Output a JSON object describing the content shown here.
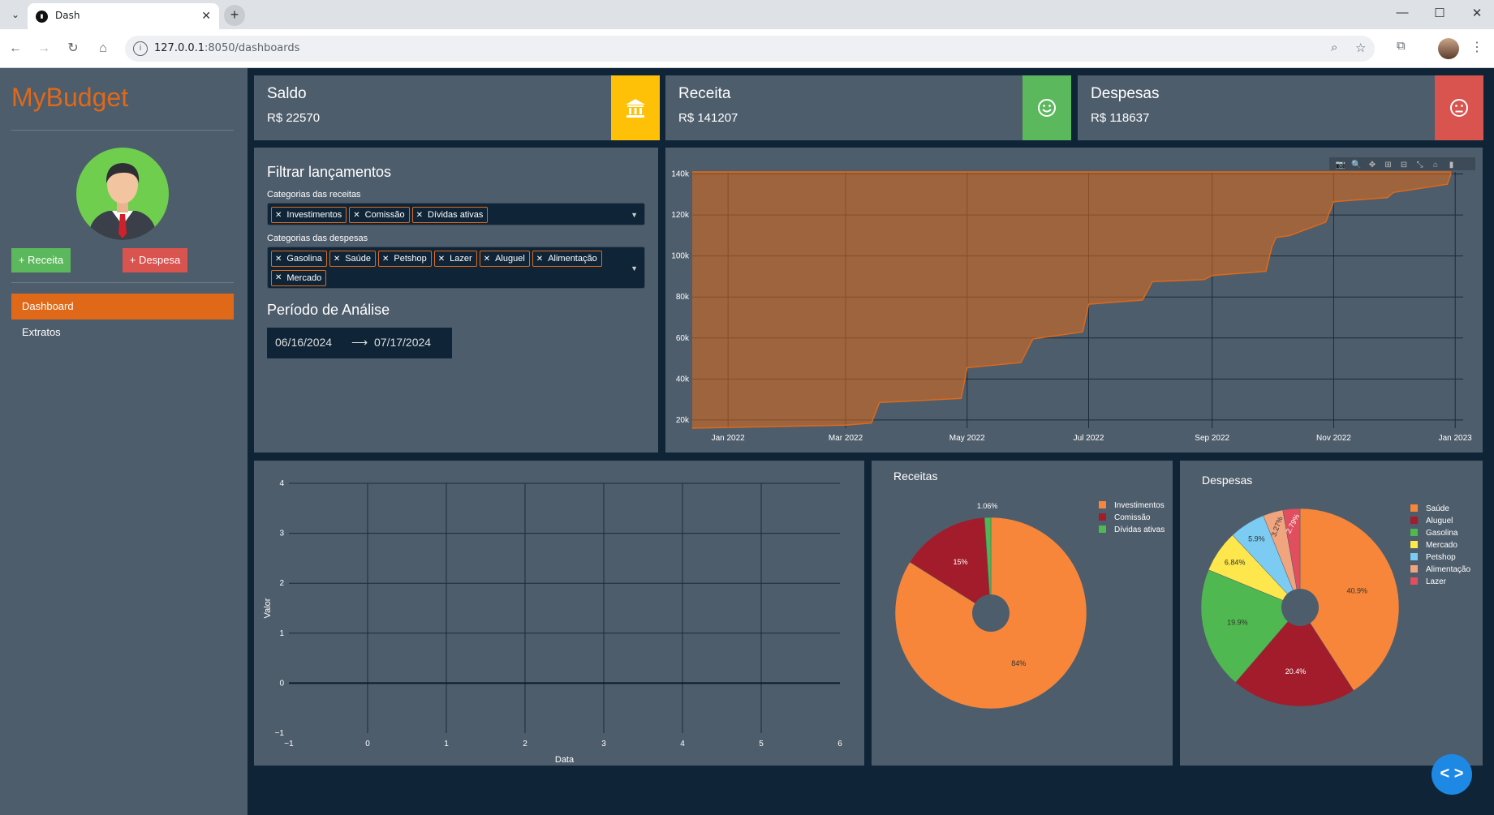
{
  "browser": {
    "tab_title": "Dash",
    "url_host": "127.0.0.1",
    "url_path": ":8050/dashboards"
  },
  "sidebar": {
    "brand": "MyBudget",
    "btn_receita": "+ Receita",
    "btn_despesa": "+ Despesa",
    "nav": [
      "Dashboard",
      "Extratos"
    ]
  },
  "kpis": {
    "saldo": {
      "title": "Saldo",
      "value": "R$ 22570",
      "color": "#ffc107"
    },
    "receita": {
      "title": "Receita",
      "value": "R$ 141207",
      "color": "#5cb85c"
    },
    "despesas": {
      "title": "Despesas",
      "value": "R$ 118637",
      "color": "#d9534f"
    }
  },
  "filter": {
    "title": "Filtrar lançamentos",
    "receitas_label": "Categorias das receitas",
    "receitas_chips": [
      "Investimentos",
      "Comissão",
      "Dívidas ativas"
    ],
    "despesas_label": "Categorias das despesas",
    "despesas_chips": [
      "Gasolina",
      "Saúde",
      "Petshop",
      "Lazer",
      "Aluguel",
      "Alimentação",
      "Mercado"
    ],
    "periodo_title": "Período de Análise",
    "date_start": "06/16/2024",
    "date_arrow": "⟶",
    "date_end": "07/17/2024"
  },
  "charts": {
    "area": {
      "type": "area",
      "x": [
        "2021-12-14",
        "2022-03-01",
        "2022-03-14",
        "2022-03-18",
        "2022-04-28",
        "2022-05-01",
        "2022-05-28",
        "2022-06-03",
        "2022-06-28",
        "2022-07-01",
        "2022-07-28",
        "2022-08-02",
        "2022-08-28",
        "2022-09-01",
        "2022-09-28",
        "2022-10-01",
        "2022-10-03",
        "2022-10-10",
        "2022-10-28",
        "2022-11-01",
        "2022-11-28",
        "2022-12-01",
        "2022-12-28",
        "2022-12-30"
      ],
      "y": [
        16000,
        17500,
        18500,
        28500,
        30500,
        45500,
        48000,
        59500,
        63000,
        76500,
        78500,
        87500,
        88500,
        90500,
        92500,
        104500,
        109000,
        110000,
        116500,
        126500,
        128500,
        131000,
        135000,
        140500
      ],
      "xticks": [
        "Jan 2022",
        "Mar 2022",
        "May 2022",
        "Jul 2022",
        "Sep 2022",
        "Nov 2022",
        "Jan 2023"
      ],
      "yticks": [
        "20k",
        "40k",
        "60k",
        "80k",
        "100k",
        "120k",
        "140k"
      ],
      "ylim": [
        16000,
        141000
      ],
      "color": "#df6919"
    },
    "empty": {
      "type": "scatter",
      "xlabel": "Data",
      "ylabel": "Valor",
      "xlim": [
        -1,
        6
      ],
      "ylim": [
        -1,
        4
      ],
      "xticks": [
        "−1",
        "0",
        "1",
        "2",
        "3",
        "4",
        "5",
        "6"
      ],
      "yticks": [
        "−1",
        "0",
        "1",
        "2",
        "3",
        "4"
      ]
    },
    "receitas_pie": {
      "type": "pie",
      "title": "Receitas",
      "labels": [
        "Investimentos",
        "Comissão",
        "Dívidas ativas"
      ],
      "values": [
        84,
        15,
        1.06
      ],
      "text": [
        "84%",
        "15%",
        "1.06%"
      ],
      "colors": [
        "#f7863a",
        "#a31c2b",
        "#4fb850"
      ]
    },
    "despesas_pie": {
      "type": "pie",
      "title": "Despesas",
      "labels": [
        "Saúde",
        "Aluguel",
        "Gasolina",
        "Mercado",
        "Petshop",
        "Alimentação",
        "Lazer"
      ],
      "values": [
        40.9,
        20.4,
        19.9,
        6.84,
        5.9,
        3.27,
        2.79
      ],
      "text": [
        "40.9%",
        "20.4%",
        "19.9%",
        "6.84%",
        "5.9%",
        "3.27%",
        "2.79%"
      ],
      "colors": [
        "#f7863a",
        "#a31c2b",
        "#4fb850",
        "#fde74c",
        "#7ccbf2",
        "#f0a57f",
        "#e04e5f"
      ]
    }
  }
}
